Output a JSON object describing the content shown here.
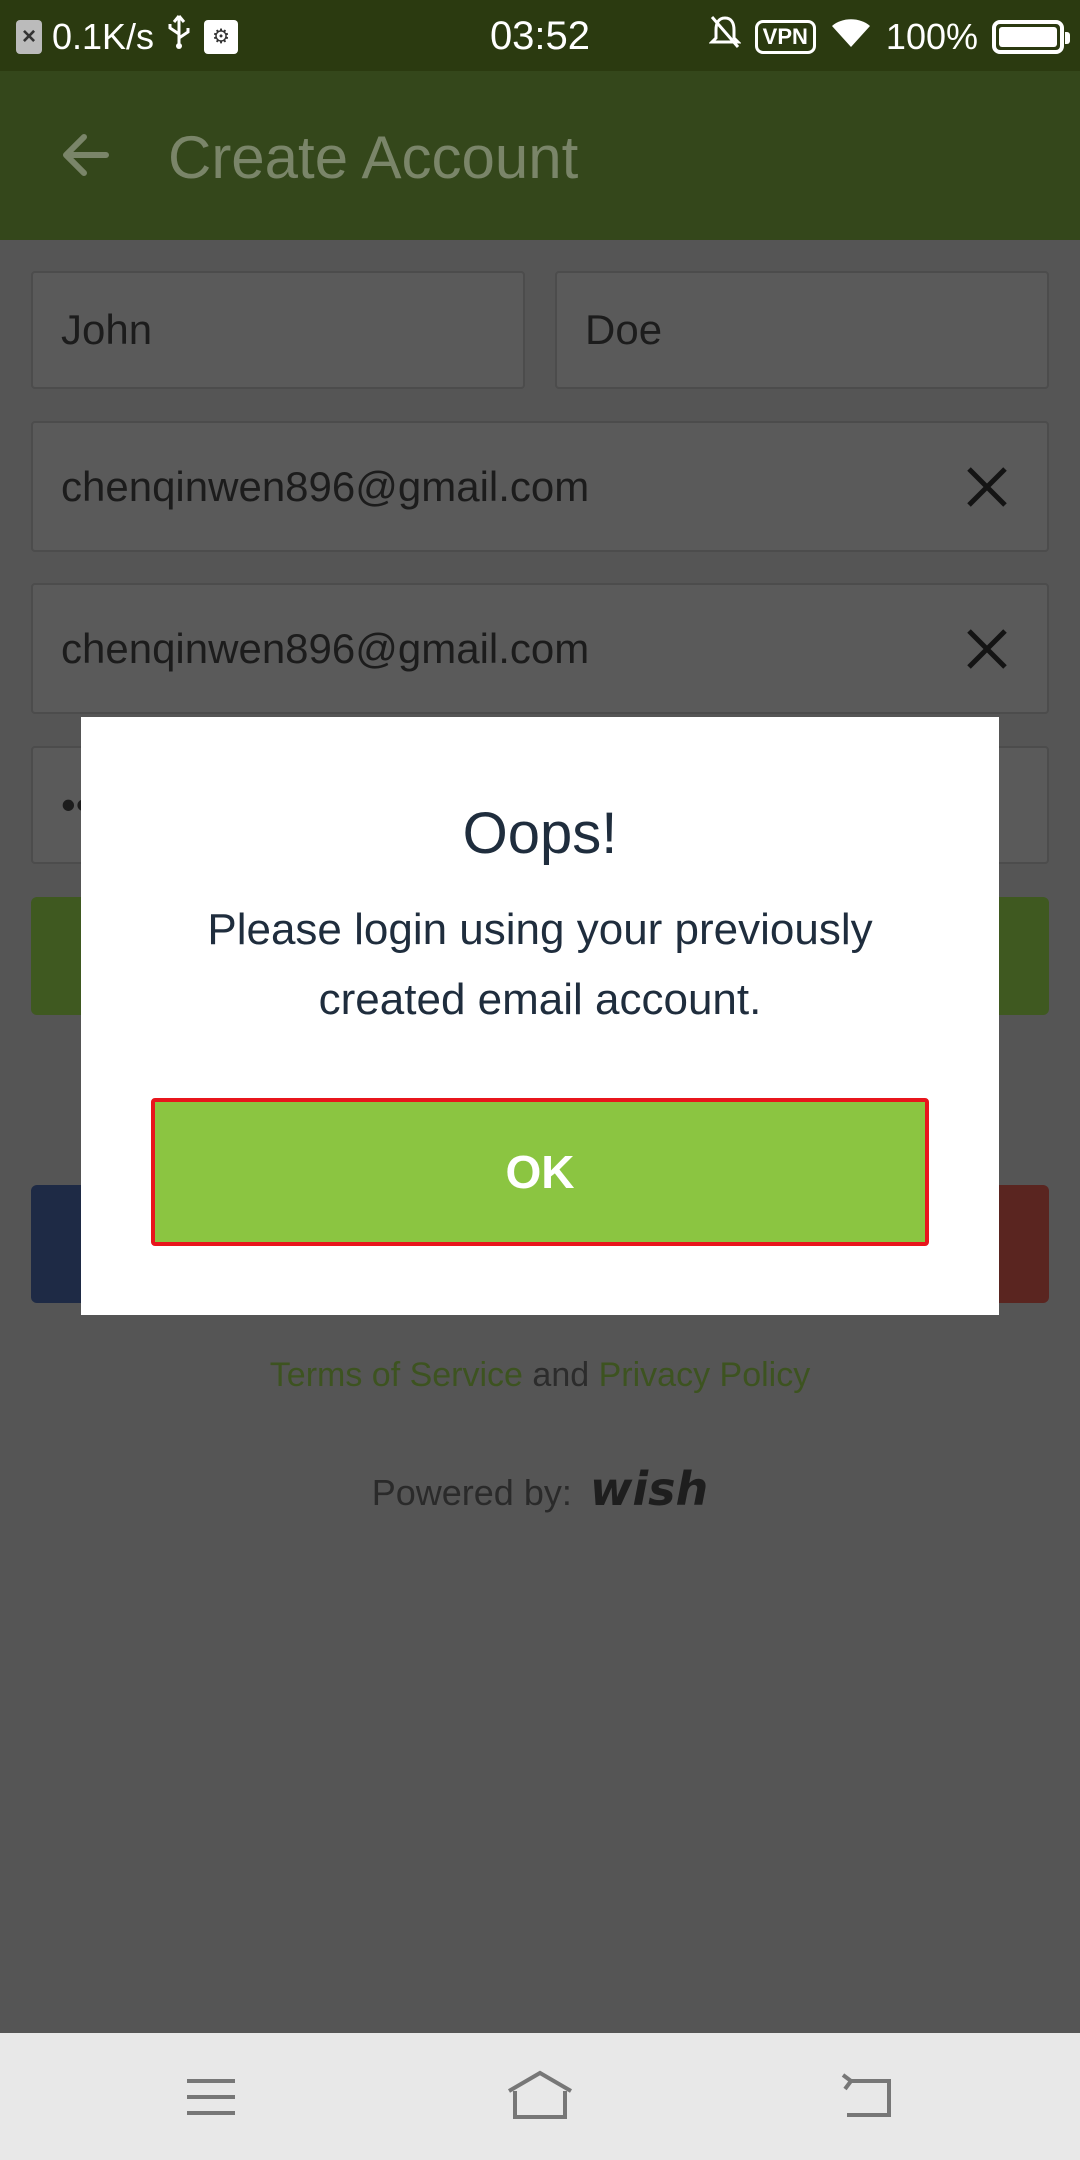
{
  "status_bar": {
    "net_speed": "0.1K/s",
    "time": "03:52",
    "vpn_label": "VPN",
    "battery": "100%"
  },
  "app_bar": {
    "title": "Create Account",
    "back_icon": "arrow-left-icon"
  },
  "form": {
    "first_name": "John",
    "last_name": "Doe",
    "email": "chenqinwen896@gmail.com",
    "confirm_email": "chenqinwen896@gmail.com",
    "password_masked": "••"
  },
  "footer": {
    "terms_link": "Terms of Service",
    "and_text": "and",
    "privacy_link": "Privacy Policy",
    "powered_by": "Powered by:",
    "brand": "wish"
  },
  "dialog": {
    "title": "Oops!",
    "message": "Please login using your previously created email account.",
    "ok_label": "OK"
  },
  "colors": {
    "primary_green": "#8bc541",
    "highlight_red": "#e8151c",
    "text_dark": "#1f2d3d"
  }
}
